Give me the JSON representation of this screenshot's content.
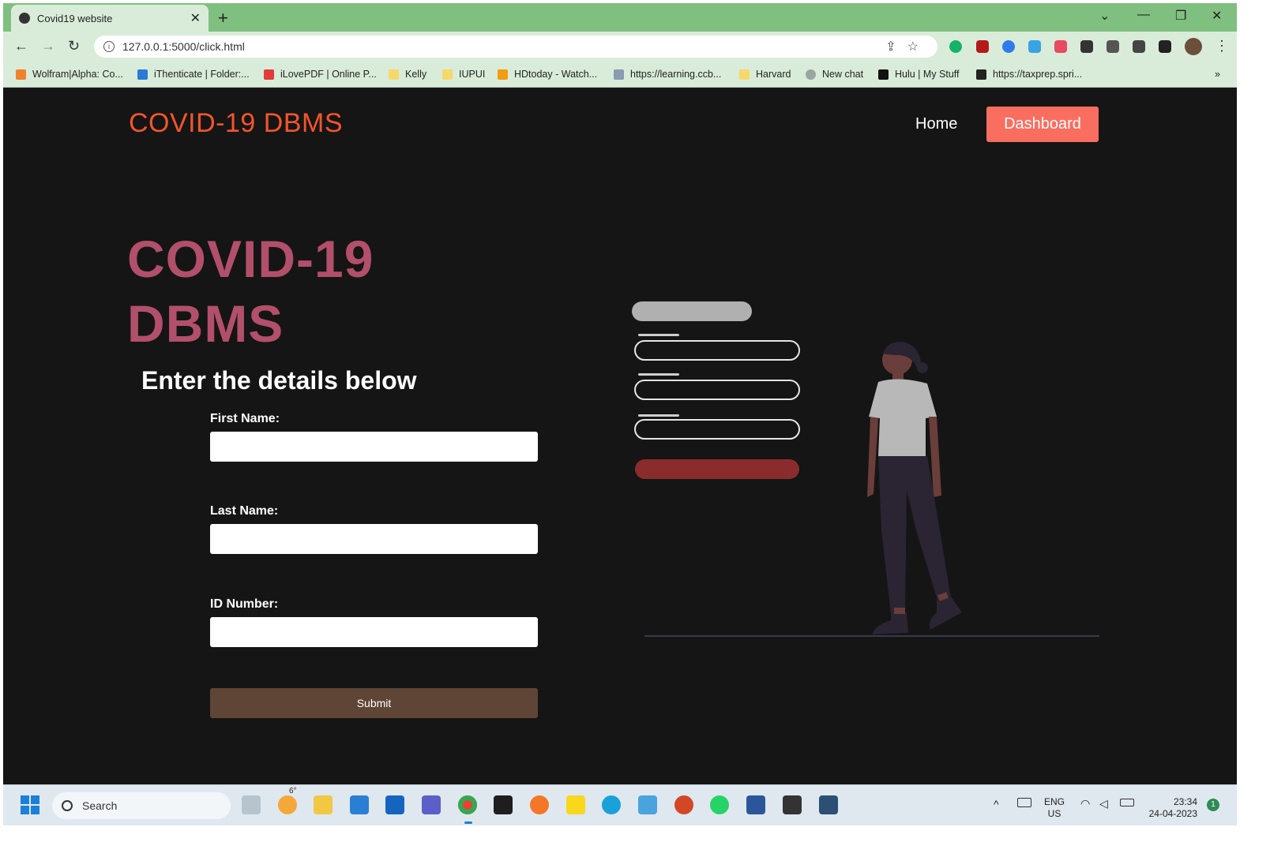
{
  "browser": {
    "tab_title": "Covid19 website",
    "tab_close": "✕",
    "new_tab": "+",
    "url": "127.0.0.1:5000/click.html",
    "window_controls": [
      "⌄",
      "—",
      "❐",
      "✕"
    ],
    "bookmarks": [
      {
        "label": "Wolfram|Alpha: Co...",
        "color": "#f0822e"
      },
      {
        "label": "iThenticate | Folder:...",
        "color": "#2b7bd6"
      },
      {
        "label": "iLovePDF | Online P...",
        "color": "#e23b3b"
      },
      {
        "label": "Kelly",
        "color": "#f6d96a"
      },
      {
        "label": "IUPUI",
        "color": "#f6d96a"
      },
      {
        "label": "HDtoday - Watch...",
        "color": "#f39c12"
      },
      {
        "label": "https://learning.ccb...",
        "color": "#8a9bb0"
      },
      {
        "label": "Harvard",
        "color": "#f6d96a"
      },
      {
        "label": "New chat",
        "color": "#9aa6a0"
      },
      {
        "label": "Hulu | My Stuff",
        "color": "#111111"
      },
      {
        "label": "https://taxprep.spri...",
        "color": "#222222"
      }
    ],
    "more_bookmarks": "»"
  },
  "site": {
    "brand": "COVID-19 DBMS",
    "nav_home": "Home",
    "nav_dashboard": "Dashboard",
    "hero_line1": "COVID-19",
    "hero_line2": "DBMS",
    "form_heading": "Enter the details below",
    "first_name_label": "First Name:",
    "last_name_label": "Last Name:",
    "id_label": "ID Number:",
    "submit_label": "Submit"
  },
  "taskbar": {
    "search_label": "Search",
    "lang_top": "ENG",
    "lang_bottom": "US",
    "time": "23:34",
    "date": "24-04-2023",
    "weather_temp": "6°"
  },
  "colors": {
    "accent_brand": "#f2552c",
    "dashboard_button": "#fa6e5f",
    "hero_title": "#b24f6b",
    "submit_button": "#5e4535",
    "chrome_green": "#7fbf7f"
  }
}
